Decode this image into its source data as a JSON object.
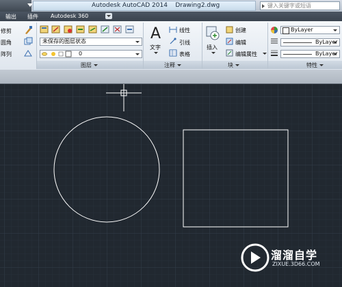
{
  "window": {
    "app_title": "Autodesk AutoCAD 2014",
    "document": "Drawing2.dwg",
    "search_placeholder": "键入关键字或短语"
  },
  "tabs": [
    "输出",
    "插件",
    "Autodesk 360"
  ],
  "ribbon": {
    "modify_partial": {
      "items": [
        "修剪",
        "圆角",
        "阵列"
      ]
    },
    "layers": {
      "panel_label": "图层",
      "layer_state": "未保存的图层状态",
      "current_layer": "0"
    },
    "annotation": {
      "panel_label": "注释",
      "text_label": "文字",
      "items": [
        "线性",
        "引线",
        "表格"
      ]
    },
    "block": {
      "panel_label": "块",
      "insert_label": "插入",
      "items": [
        "创建",
        "编辑",
        "编辑属性"
      ]
    },
    "properties": {
      "panel_label": "特性",
      "color": "ByLayer",
      "linetype": "ByLayer",
      "lineweight": "ByLayer"
    }
  },
  "watermark": {
    "brand": "溜溜自学",
    "site": "ZIXUE.3D66.COM"
  },
  "colors": {
    "canvas_bg": "#212830",
    "grid": "#2f3843",
    "geometry": "#ffffff"
  }
}
